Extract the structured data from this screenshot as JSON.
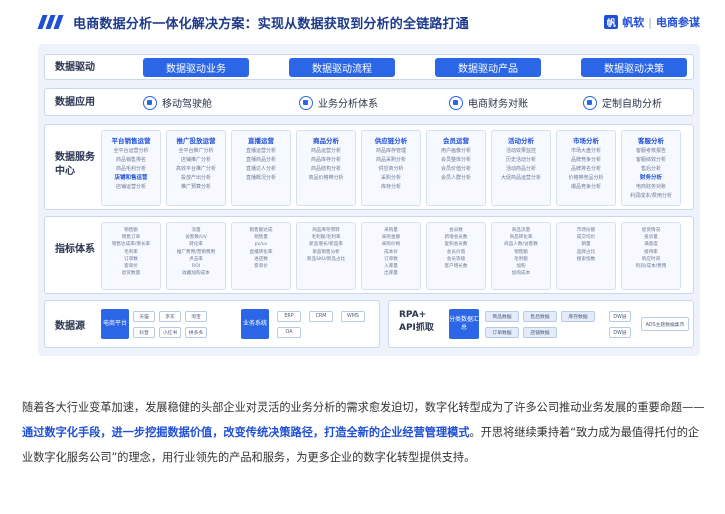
{
  "header": {
    "title": "电商数据分析一体化解决方案：实现从数据获取到分析的全链路打通",
    "brand_name": "帆软",
    "brand_sep": "|",
    "brand_sub": "电商参谋",
    "brand_icon": "帆"
  },
  "rows": {
    "drive": {
      "label": "数据驱动",
      "buttons": [
        "数据驱动业务",
        "数据驱动流程",
        "数据驱动产品",
        "数据驱动决策"
      ]
    },
    "apps": {
      "label": "数据应用",
      "items": [
        "移动驾驶舱",
        "业务分析体系",
        "电商财务对账",
        "定制自助分析"
      ]
    },
    "services": {
      "label": "数据服务中心",
      "columns": [
        {
          "title": "平台销售运营",
          "lines": [
            "全平台运营分析",
            "商品销售排名",
            "商品毛利分析",
            "店铺和售运营",
            "店铺运营分析"
          ],
          "strong": 3
        },
        {
          "title": "推广投放运营",
          "lines": [
            "全平台推广分析",
            "店铺推广分析",
            "高效平台推广分析",
            "投放产出分析",
            "推广预算分析"
          ],
          "strong": -1
        },
        {
          "title": "直播运营",
          "lines": [
            "直播运营分析",
            "直播商品分析",
            "直播达人分析",
            "直播概况分析"
          ],
          "strong": -1
        },
        {
          "title": "商品分析",
          "lines": [
            "商品运营分析",
            "商品库存分析",
            "商品结构分析",
            "商品价格带分析"
          ],
          "strong": -1
        },
        {
          "title": "供应链分析",
          "lines": [
            "商品库存管理",
            "商品采购分析",
            "供应商分析",
            "采购分析",
            "库存分析"
          ],
          "strong": -1
        },
        {
          "title": "会员运营",
          "lines": [
            "用户画像分析",
            "会员整体分析",
            "会员价值分析",
            "会员人群分析"
          ],
          "strong": -1
        },
        {
          "title": "活动分析",
          "lines": [
            "活动效果监控",
            "历史活动分析",
            "活动商品分析",
            "大促商品运营分析"
          ],
          "strong": -1
        },
        {
          "title": "市场分析",
          "lines": [
            "市场大盘分析",
            "品牌竞争分析",
            "品牌排名分析",
            "价格带竞品分析",
            "爆品竞争分析"
          ],
          "strong": -1
        },
        {
          "title": "客服分析",
          "lines": [
            "客服考核报告",
            "客服绩效分析",
            "售后分析",
            "财务分析",
            "电商财务对账",
            "利润成本/费用分析"
          ],
          "strong": 3
        }
      ]
    },
    "kpis": {
      "label": "指标体系",
      "columns": [
        [
          "销售额",
          "销售订单",
          "销售达成率/增长率",
          "毛利率",
          "订单数",
          "客单价",
          "退货数量"
        ],
        [
          "流量",
          "访客数/UV",
          "转化率",
          "推广费用/营销费用",
          "点击率",
          "ROI",
          "收藏加购成本"
        ],
        [
          "销售额达成",
          "销售量",
          "pv/uv",
          "直播转化率",
          "进店数",
          "客单价"
        ],
        [
          "商品库存周转",
          "毛利额/毛利率",
          "新品增长/新品率",
          "单品销售分析",
          "新品SKU/新品占比"
        ],
        [
          "采购量",
          "采购金额",
          "采购价格",
          "成本价",
          "订单数",
          "入库量",
          "出库量"
        ],
        [
          "会员数",
          "新增会员数",
          "复购会员数",
          "会员价值",
          "会员等级",
          "客户增长数"
        ],
        [
          "商品流量",
          "商品转化率",
          "商品人数/访客数",
          "销售额",
          "毛利额",
          "加购",
          "加购成本"
        ],
        [
          "市场份额",
          "成交均价",
          "销量",
          "品牌占比",
          "搜索指数"
        ],
        [
          "退货情况",
          "投诉量",
          "满意度",
          "接待率",
          "响应时间",
          "利润/成本/费用"
        ]
      ]
    },
    "sources": {
      "label": "数据源",
      "ecom_main": "电商平台",
      "ecom_chips": [
        "天猫",
        "京东",
        "淘宝",
        "抖音",
        "小红书",
        "拼多多"
      ],
      "biz_main": "业务系统",
      "biz_chips": [
        "ERP",
        "CRM",
        "WMS",
        "OA"
      ],
      "rpa_label_1": "RPA+",
      "rpa_label_2": "API抓取",
      "rpa_main": "分类数据汇总",
      "rpa_chips": [
        "商品数据",
        "售后数据",
        "库存数据",
        "订单数据",
        "店铺数据"
      ],
      "dw_chips": [
        "DW层",
        "DW层"
      ],
      "ads_chip": "ADS主题数据集市"
    }
  },
  "paragraph": {
    "part1": "随着各大行业变革加速，发展稳健的头部企业对灵活的业务分析的需求愈发迫切，数字化转型成为了许多公司推动业务发展的重要命题——",
    "highlight": "通过数字化手段，进一步挖掘数据价值，改变传统决策路径，打造全新的企业经营管理模式",
    "part2": "。开思将继续秉持着“致力成为最值得托付的企业数字化服务公司”的理念，用行业领先的产品和服务，为更多企业的数字化转型提供支持。"
  },
  "colors": {
    "accent": "#2b66e6",
    "title": "#1d3a8a",
    "panel": "#eef3fb"
  }
}
